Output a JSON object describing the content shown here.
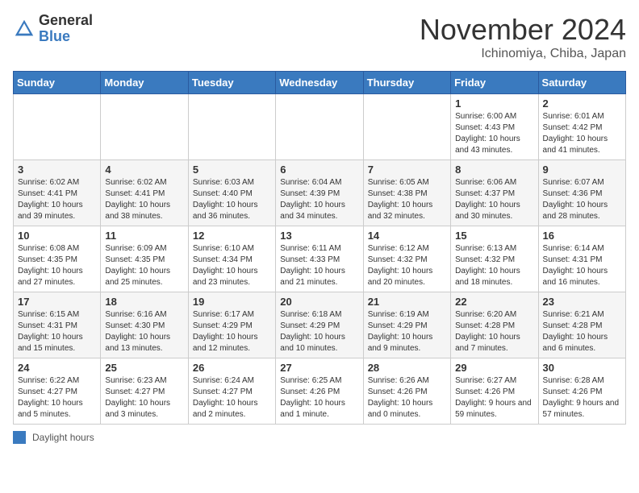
{
  "header": {
    "logo_general": "General",
    "logo_blue": "Blue",
    "month_title": "November 2024",
    "location": "Ichinomiya, Chiba, Japan"
  },
  "weekdays": [
    "Sunday",
    "Monday",
    "Tuesday",
    "Wednesday",
    "Thursday",
    "Friday",
    "Saturday"
  ],
  "weeks": [
    [
      {
        "day": "",
        "info": ""
      },
      {
        "day": "",
        "info": ""
      },
      {
        "day": "",
        "info": ""
      },
      {
        "day": "",
        "info": ""
      },
      {
        "day": "",
        "info": ""
      },
      {
        "day": "1",
        "info": "Sunrise: 6:00 AM\nSunset: 4:43 PM\nDaylight: 10 hours and 43 minutes."
      },
      {
        "day": "2",
        "info": "Sunrise: 6:01 AM\nSunset: 4:42 PM\nDaylight: 10 hours and 41 minutes."
      }
    ],
    [
      {
        "day": "3",
        "info": "Sunrise: 6:02 AM\nSunset: 4:41 PM\nDaylight: 10 hours and 39 minutes."
      },
      {
        "day": "4",
        "info": "Sunrise: 6:02 AM\nSunset: 4:41 PM\nDaylight: 10 hours and 38 minutes."
      },
      {
        "day": "5",
        "info": "Sunrise: 6:03 AM\nSunset: 4:40 PM\nDaylight: 10 hours and 36 minutes."
      },
      {
        "day": "6",
        "info": "Sunrise: 6:04 AM\nSunset: 4:39 PM\nDaylight: 10 hours and 34 minutes."
      },
      {
        "day": "7",
        "info": "Sunrise: 6:05 AM\nSunset: 4:38 PM\nDaylight: 10 hours and 32 minutes."
      },
      {
        "day": "8",
        "info": "Sunrise: 6:06 AM\nSunset: 4:37 PM\nDaylight: 10 hours and 30 minutes."
      },
      {
        "day": "9",
        "info": "Sunrise: 6:07 AM\nSunset: 4:36 PM\nDaylight: 10 hours and 28 minutes."
      }
    ],
    [
      {
        "day": "10",
        "info": "Sunrise: 6:08 AM\nSunset: 4:35 PM\nDaylight: 10 hours and 27 minutes."
      },
      {
        "day": "11",
        "info": "Sunrise: 6:09 AM\nSunset: 4:35 PM\nDaylight: 10 hours and 25 minutes."
      },
      {
        "day": "12",
        "info": "Sunrise: 6:10 AM\nSunset: 4:34 PM\nDaylight: 10 hours and 23 minutes."
      },
      {
        "day": "13",
        "info": "Sunrise: 6:11 AM\nSunset: 4:33 PM\nDaylight: 10 hours and 21 minutes."
      },
      {
        "day": "14",
        "info": "Sunrise: 6:12 AM\nSunset: 4:32 PM\nDaylight: 10 hours and 20 minutes."
      },
      {
        "day": "15",
        "info": "Sunrise: 6:13 AM\nSunset: 4:32 PM\nDaylight: 10 hours and 18 minutes."
      },
      {
        "day": "16",
        "info": "Sunrise: 6:14 AM\nSunset: 4:31 PM\nDaylight: 10 hours and 16 minutes."
      }
    ],
    [
      {
        "day": "17",
        "info": "Sunrise: 6:15 AM\nSunset: 4:31 PM\nDaylight: 10 hours and 15 minutes."
      },
      {
        "day": "18",
        "info": "Sunrise: 6:16 AM\nSunset: 4:30 PM\nDaylight: 10 hours and 13 minutes."
      },
      {
        "day": "19",
        "info": "Sunrise: 6:17 AM\nSunset: 4:29 PM\nDaylight: 10 hours and 12 minutes."
      },
      {
        "day": "20",
        "info": "Sunrise: 6:18 AM\nSunset: 4:29 PM\nDaylight: 10 hours and 10 minutes."
      },
      {
        "day": "21",
        "info": "Sunrise: 6:19 AM\nSunset: 4:29 PM\nDaylight: 10 hours and 9 minutes."
      },
      {
        "day": "22",
        "info": "Sunrise: 6:20 AM\nSunset: 4:28 PM\nDaylight: 10 hours and 7 minutes."
      },
      {
        "day": "23",
        "info": "Sunrise: 6:21 AM\nSunset: 4:28 PM\nDaylight: 10 hours and 6 minutes."
      }
    ],
    [
      {
        "day": "24",
        "info": "Sunrise: 6:22 AM\nSunset: 4:27 PM\nDaylight: 10 hours and 5 minutes."
      },
      {
        "day": "25",
        "info": "Sunrise: 6:23 AM\nSunset: 4:27 PM\nDaylight: 10 hours and 3 minutes."
      },
      {
        "day": "26",
        "info": "Sunrise: 6:24 AM\nSunset: 4:27 PM\nDaylight: 10 hours and 2 minutes."
      },
      {
        "day": "27",
        "info": "Sunrise: 6:25 AM\nSunset: 4:26 PM\nDaylight: 10 hours and 1 minute."
      },
      {
        "day": "28",
        "info": "Sunrise: 6:26 AM\nSunset: 4:26 PM\nDaylight: 10 hours and 0 minutes."
      },
      {
        "day": "29",
        "info": "Sunrise: 6:27 AM\nSunset: 4:26 PM\nDaylight: 9 hours and 59 minutes."
      },
      {
        "day": "30",
        "info": "Sunrise: 6:28 AM\nSunset: 4:26 PM\nDaylight: 9 hours and 57 minutes."
      }
    ]
  ],
  "legend": {
    "box_label": "Daylight hours"
  }
}
